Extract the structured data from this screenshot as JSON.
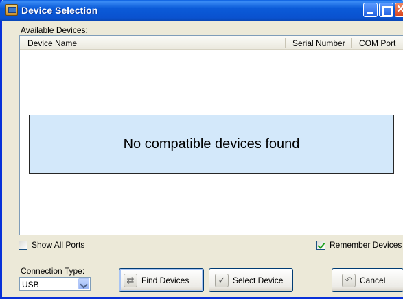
{
  "window": {
    "title": "Device Selection"
  },
  "list": {
    "label": "Available Devices:",
    "columns": [
      "Device Name",
      "Serial Number",
      "COM Port"
    ],
    "empty_message": "No compatible devices found"
  },
  "options": {
    "show_all_ports": {
      "label": "Show All Ports",
      "checked": false
    },
    "remember_devices": {
      "label": "Remember Devices",
      "checked": true
    }
  },
  "connection": {
    "label": "Connection Type:",
    "selected": "USB"
  },
  "buttons": {
    "find": "Find Devices",
    "select": "Select Device",
    "cancel": "Cancel"
  },
  "icons": {
    "app": "device-app-icon",
    "minimize": "minimize-icon",
    "maximize": "maximize-icon",
    "close": "close-icon",
    "find": "refresh-arrows-icon",
    "select": "checkmark-icon",
    "cancel": "undo-arrow-icon",
    "dropdown": "chevron-down-icon"
  },
  "colors": {
    "titlebar": "#0a52cf",
    "empty_box": "#d3e8fa",
    "dialog_bg": "#ece9d8"
  }
}
